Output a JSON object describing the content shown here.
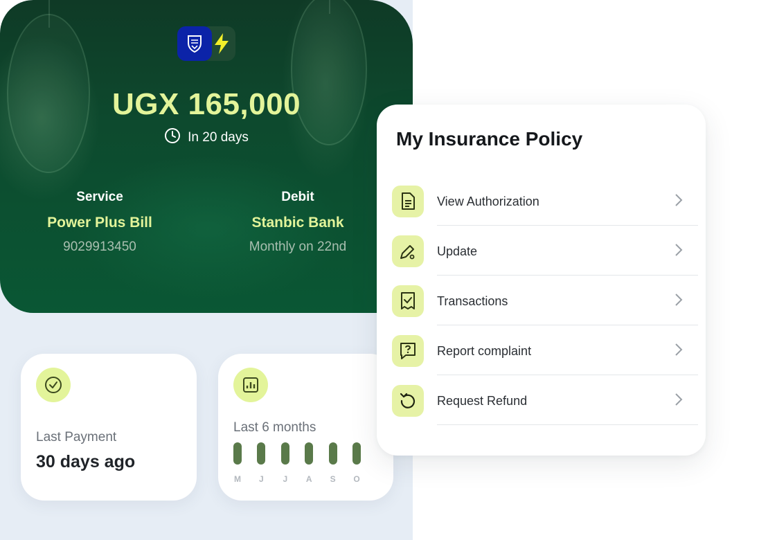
{
  "summary": {
    "amount": "UGX 165,000",
    "due_text": "In 20 days",
    "service_label": "Service",
    "service_value": "Power Plus Bill",
    "service_sub": "9029913450",
    "debit_label": "Debit",
    "debit_value": "Stanbic Bank",
    "debit_sub": "Monthly on 22nd"
  },
  "last_payment": {
    "label": "Last Payment",
    "value": "30 days ago",
    "icon": "check-circle-icon"
  },
  "history": {
    "label": "Last 6 months",
    "icon": "bar-chart-icon",
    "months": [
      "M",
      "J",
      "J",
      "A",
      "S",
      "O"
    ]
  },
  "insurance": {
    "title": "My Insurance Policy",
    "items": [
      {
        "label": "View Authorization",
        "icon": "document-icon"
      },
      {
        "label": "Update",
        "icon": "edit-icon"
      },
      {
        "label": "Transactions",
        "icon": "receipt-check-icon"
      },
      {
        "label": "Report complaint",
        "icon": "question-message-icon"
      },
      {
        "label": "Request Refund",
        "icon": "refund-icon"
      }
    ]
  },
  "colors": {
    "accent_lime": "#e3f49a",
    "hero_green": "#0d4a2e",
    "bank_blue": "#0b23a8",
    "bar_green": "#5a7a4a"
  }
}
